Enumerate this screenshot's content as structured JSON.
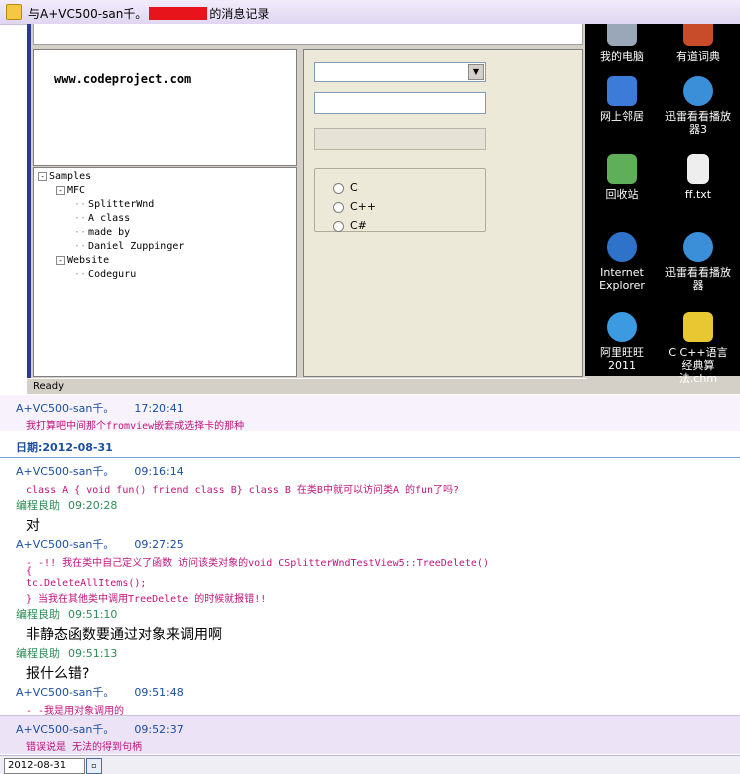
{
  "window": {
    "title_prefix": "与A+VC500-san千。",
    "title_suffix": "的消息记录"
  },
  "app": {
    "url_text": "www.codeproject.com",
    "tree": [
      {
        "label": "Samples",
        "level": 0,
        "expander": "-"
      },
      {
        "label": "MFC",
        "level": 1,
        "expander": "-"
      },
      {
        "label": "SplitterWnd",
        "level": 2,
        "expander": ""
      },
      {
        "label": "A class",
        "level": 2,
        "expander": ""
      },
      {
        "label": "made by",
        "level": 2,
        "expander": ""
      },
      {
        "label": "Daniel Zuppinger",
        "level": 2,
        "expander": ""
      },
      {
        "label": "Website",
        "level": 1,
        "expander": "-"
      },
      {
        "label": "Codeguru",
        "level": 2,
        "expander": ""
      }
    ],
    "radios": [
      "C",
      "C++",
      "C#"
    ],
    "status": "Ready"
  },
  "desktop": {
    "icons": [
      {
        "label": "我的电脑",
        "icon": "my-computer-icon",
        "color": "#9aa7b8"
      },
      {
        "label": "有道词典",
        "icon": "dictionary-icon",
        "color": "#c84b2a"
      },
      {
        "label": "网上邻居",
        "icon": "network-icon",
        "color": "#3c7bd8"
      },
      {
        "label": "迅雷看看播放器3",
        "icon": "player-icon",
        "color": "#3b8fd8"
      },
      {
        "label": "回收站",
        "icon": "recycle-bin-icon",
        "color": "#5fae5a"
      },
      {
        "label": "ff.txt",
        "icon": "text-file-icon",
        "color": "#eeeeee"
      },
      {
        "label": "Internet Explorer",
        "icon": "ie-icon",
        "color": "#2f72c9"
      },
      {
        "label": "迅雷看看播放器",
        "icon": "player-icon",
        "color": "#3b8fd8"
      },
      {
        "label": "阿里旺旺2011",
        "icon": "aliwangwang-icon",
        "color": "#3c9be0"
      },
      {
        "label": "C C++语言经典算法.chm",
        "icon": "chm-help-icon",
        "color": "#e8c832"
      }
    ]
  },
  "chat": {
    "user1": "A+VC500-san千。",
    "user2": "编程良助",
    "first": {
      "time": "17:20:41",
      "text": "我打算吧中间那个fromview嵌套成选择卡的那种"
    },
    "date_label": "日期:2012-08-31",
    "m1": {
      "time": "09:16:14",
      "text": "class A {  void fun() friend class B}  class B  在类B中就可以访问类A 的fun了吗?"
    },
    "m2": {
      "time": "09:20:28",
      "text": "对"
    },
    "m3": {
      "time": "09:27:25",
      "line1": "- -!!  我在类中自己定义了函数 访问该类对象的void CSplitterWndTestView5::TreeDelete()",
      "line2": "{",
      "line3": "tc.DeleteAllItems();",
      "line4": "}  当我在其他类中调用TreeDelete 的时候就报错!!"
    },
    "m4": {
      "time": "09:51:10",
      "text": "非静态函数要通过对象来调用啊"
    },
    "m5": {
      "time": "09:51:13",
      "text": "报什么错?"
    },
    "m6": {
      "time": "09:51:48",
      "text": "- -我是用对象调用的"
    },
    "m7": {
      "time": "09:52:37",
      "text": "错误说是 无法的得到句柄"
    }
  },
  "footer": {
    "date": "2012-08-31"
  }
}
